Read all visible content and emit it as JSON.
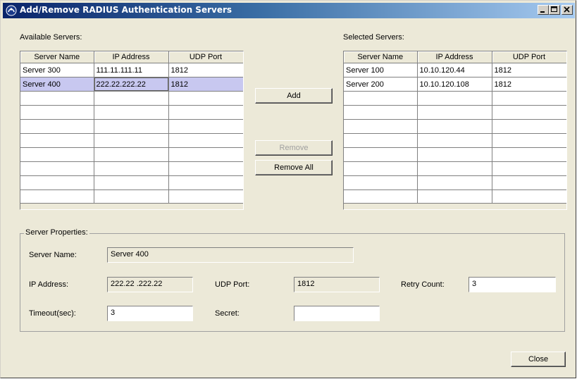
{
  "window": {
    "title": "Add/Remove RADIUS Authentication Servers",
    "minimize_label": "_",
    "maximize_label": "□",
    "close_label": "×"
  },
  "available": {
    "label": "Available Servers:",
    "columns": [
      "Server Name",
      "IP Address",
      "UDP Port"
    ],
    "rows": [
      [
        "Server 300",
        "111.11.111.11",
        "1812"
      ],
      [
        "Server 400",
        "222.22.222.22",
        "1812"
      ]
    ],
    "selected_row": 1
  },
  "selected": {
    "label": "Selected Servers:",
    "columns": [
      "Server Name",
      "IP Address",
      "UDP Port"
    ],
    "rows": [
      [
        "Server 100",
        "10.10.120.44",
        "1812"
      ],
      [
        "Server 200",
        "10.10.120.108",
        "1812"
      ]
    ]
  },
  "actions": {
    "add": "Add",
    "remove": "Remove",
    "remove_all": "Remove All",
    "close": "Close"
  },
  "properties": {
    "legend": "Server Properties:",
    "server_name_label": "Server Name:",
    "server_name_value": "Server 400",
    "ip_label": "IP Address:",
    "ip_value": "222.22 .222.22",
    "udp_label": "UDP Port:",
    "udp_value": "1812",
    "retry_label": "Retry Count:",
    "retry_value": "3",
    "timeout_label": "Timeout(sec):",
    "timeout_value": "3",
    "secret_label": "Secret:",
    "secret_value": ""
  },
  "colors": {
    "selection": "#c8c8f0",
    "dialog_bg": "#ece9d8",
    "titlebar_start": "#0a246a"
  }
}
